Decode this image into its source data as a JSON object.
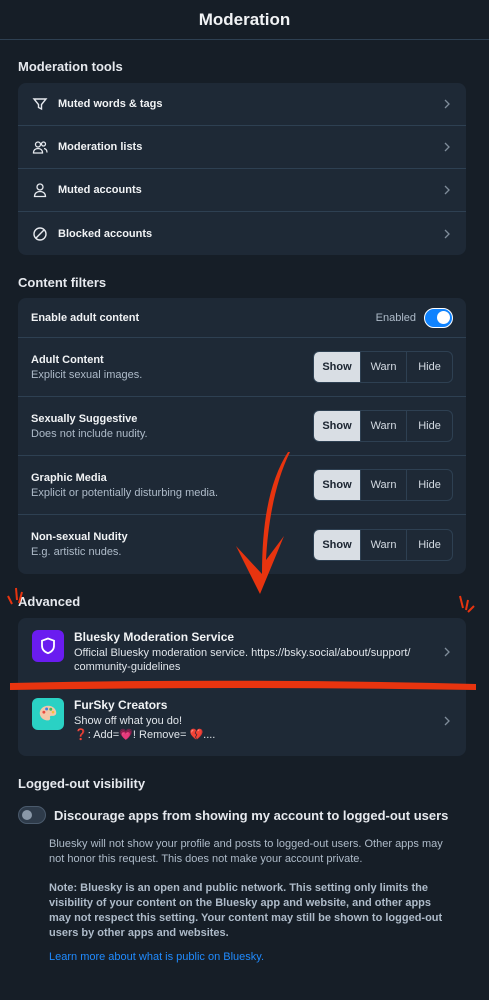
{
  "header": {
    "title": "Moderation"
  },
  "moderation_tools": {
    "title": "Moderation tools",
    "items": [
      {
        "label": "Muted words & tags",
        "icon": "filter-icon"
      },
      {
        "label": "Moderation lists",
        "icon": "users-icon"
      },
      {
        "label": "Muted accounts",
        "icon": "person-icon"
      },
      {
        "label": "Blocked accounts",
        "icon": "block-icon"
      }
    ]
  },
  "content_filters": {
    "title": "Content filters",
    "adult": {
      "label": "Enable adult content",
      "state": "Enabled"
    },
    "filters": [
      {
        "title": "Adult Content",
        "desc": "Explicit sexual images."
      },
      {
        "title": "Sexually Suggestive",
        "desc": "Does not include nudity."
      },
      {
        "title": "Graphic Media",
        "desc": "Explicit or potentially disturbing media."
      },
      {
        "title": "Non-sexual Nudity",
        "desc": "E.g. artistic nudes."
      }
    ],
    "options": {
      "show": "Show",
      "warn": "Warn",
      "hide": "Hide"
    }
  },
  "advanced": {
    "title": "Advanced",
    "labelers": [
      {
        "name": "Bluesky Moderation Service",
        "desc1": "Official Bluesky moderation service. https://bsky.social/about/support/",
        "desc2": "community-guidelines"
      },
      {
        "name": "FurSky Creators",
        "desc1": "Show off what you do!",
        "desc2": "❓: Add=💗! Remove= 💔...."
      }
    ]
  },
  "logged_out": {
    "title": "Logged-out visibility",
    "toggle_label": "Discourage apps from showing my account to logged-out users",
    "note1": "Bluesky will not show your profile and posts to logged-out users. Other apps may not honor this request. This does not make your account private.",
    "note2": "Note: Bluesky is an open and public network. This setting only limits the visibility of your content on the Bluesky app and website, and other apps may not respect this setting. Your content may still be shown to logged-out users by other apps and websites.",
    "link": "Learn more about what is public on Bluesky."
  },
  "colors": {
    "accent": "#1083fe",
    "annotation": "#e8340f"
  }
}
